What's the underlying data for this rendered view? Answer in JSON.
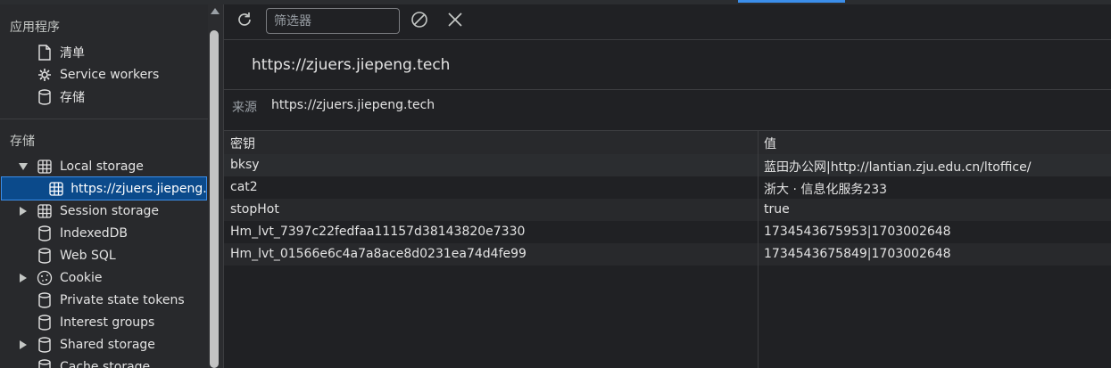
{
  "sidebar": {
    "app_section": "应用程序",
    "app_items": [
      {
        "label": "清单",
        "icon": "file-icon"
      },
      {
        "label": "Service workers",
        "icon": "gear-icon"
      },
      {
        "label": "存储",
        "icon": "database-icon"
      }
    ],
    "storage_section": "存储",
    "storage_items": [
      {
        "label": "Local storage",
        "icon": "table-icon",
        "expanded": true
      },
      {
        "label": "https://zjuers.jiepeng.t",
        "icon": "table-icon",
        "selected": true
      },
      {
        "label": "Session storage",
        "icon": "table-icon",
        "expanded": false
      },
      {
        "label": "IndexedDB",
        "icon": "database-icon"
      },
      {
        "label": "Web SQL",
        "icon": "database-icon"
      },
      {
        "label": "Cookie",
        "icon": "cookie-icon",
        "expanded": false
      },
      {
        "label": "Private state tokens",
        "icon": "database-icon"
      },
      {
        "label": "Interest groups",
        "icon": "database-icon"
      },
      {
        "label": "Shared storage",
        "icon": "database-icon",
        "expanded": false
      },
      {
        "label": "Cache storage",
        "icon": "database-icon"
      }
    ]
  },
  "toolbar": {
    "refresh_icon": "refresh-icon",
    "filter_placeholder": "筛选器",
    "clear_icon": "block-icon",
    "close_icon": "close-icon"
  },
  "main": {
    "origin_title": "https://zjuers.jiepeng.tech",
    "source_label": "来源",
    "source_value": "https://zjuers.jiepeng.tech"
  },
  "table": {
    "headers": {
      "key": "密钥",
      "value": "值"
    },
    "rows": [
      {
        "key": "bksy",
        "value": "蓝田办公网|http://lantian.zju.edu.cn/ltoffice/"
      },
      {
        "key": "cat2",
        "value": "浙大 · 信息化服务233"
      },
      {
        "key": "stopHot",
        "value": "true"
      },
      {
        "key": "Hm_lvt_7397c22fedfaa11157d38143820e7330",
        "value": "1734543675953|1703002648"
      },
      {
        "key": "Hm_lvt_01566e6c4a7a8ace8d0231ea74d4fe99",
        "value": "1734543675849|1703002648"
      }
    ]
  },
  "colors": {
    "accent": "#3b8eea",
    "selected_bg": "#0b4a8b"
  }
}
